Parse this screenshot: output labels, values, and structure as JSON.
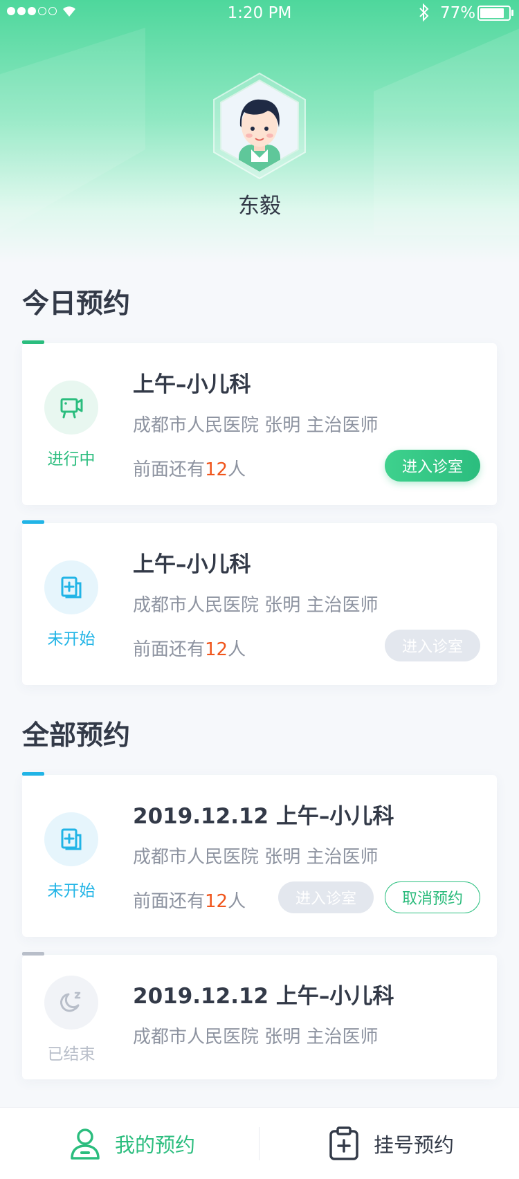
{
  "status_bar": {
    "time": "1:20 PM",
    "battery": "77%"
  },
  "profile": {
    "name": "东毅"
  },
  "sections": {
    "today_title": "今日预约",
    "all_title": "全部预约"
  },
  "today": [
    {
      "status": "进行中",
      "status_icon": "video-camera-icon",
      "title": "上午–小儿科",
      "subtitle": "成都市人民医院 张明 主治医师",
      "queue_prefix": "前面还有",
      "queue_count": "12",
      "queue_suffix": "人",
      "enter_label": "进入诊室"
    },
    {
      "status": "未开始",
      "status_icon": "medical-plus-icon",
      "title": "上午–小儿科",
      "subtitle": "成都市人民医院 张明 主治医师",
      "queue_prefix": "前面还有",
      "queue_count": "12",
      "queue_suffix": "人",
      "enter_label": "进入诊室"
    }
  ],
  "all": [
    {
      "status": "未开始",
      "status_icon": "medical-plus-icon",
      "title": "2019.12.12 上午–小儿科",
      "subtitle": "成都市人民医院 张明 主治医师",
      "queue_prefix": "前面还有",
      "queue_count": "12",
      "queue_suffix": "人",
      "enter_label": "进入诊室",
      "cancel_label": "取消预约"
    },
    {
      "status": "已结束",
      "status_icon": "moon-sleep-icon",
      "title": "2019.12.12 上午–小儿科",
      "subtitle": "成都市人民医院 张明 主治医师"
    }
  ],
  "bottom_nav": {
    "my_appointments": "我的预约",
    "register": "挂号预约"
  },
  "colors": {
    "accent_green": "#2bbd7e",
    "accent_blue": "#21b4e6",
    "queue_number": "#f0561d",
    "ended_gray": "#b8bec9"
  }
}
